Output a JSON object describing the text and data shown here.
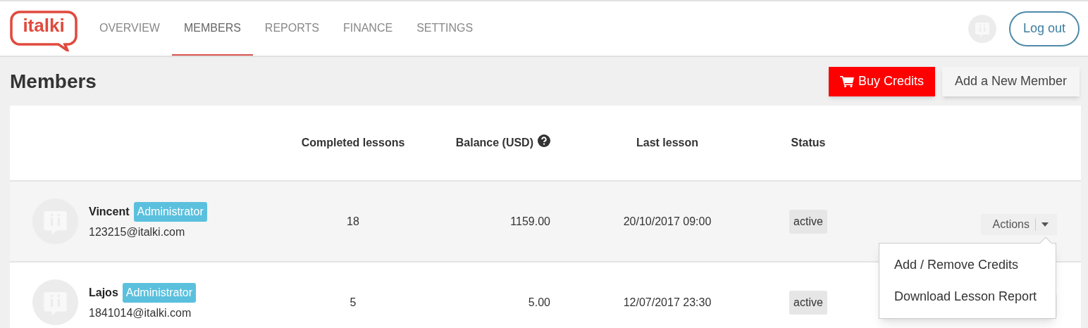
{
  "logo": "italki",
  "nav": [
    {
      "label": "OVERVIEW",
      "selected": false
    },
    {
      "label": "MEMBERS",
      "selected": true
    },
    {
      "label": "REPORTS",
      "selected": false
    },
    {
      "label": "FINANCE",
      "selected": false
    },
    {
      "label": "SETTINGS",
      "selected": false
    }
  ],
  "logout_button": "Log out",
  "page_title": "Members",
  "buy_credits_button": "Buy Credits",
  "add_member_button": "Add a New Member",
  "table": {
    "columns": [
      "Completed lessons",
      "Balance (USD)",
      "Last lesson",
      "Status"
    ],
    "rows": [
      {
        "name": "Vincent",
        "role": "Administrator",
        "email": "123215@italki.com",
        "completed": "18",
        "balance": "1159.00",
        "last_lesson": "20/10/2017 09:00",
        "status": "active",
        "actions_label": "Actions",
        "menu_open": true,
        "menu": [
          "Add / Remove Credits",
          "Download Lesson Report"
        ]
      },
      {
        "name": "Lajos",
        "role": "Administrator",
        "email": "1841014@italki.com",
        "completed": "5",
        "balance": "5.00",
        "last_lesson": "12/07/2017 23:30",
        "status": "active",
        "menu_open": false
      }
    ]
  }
}
